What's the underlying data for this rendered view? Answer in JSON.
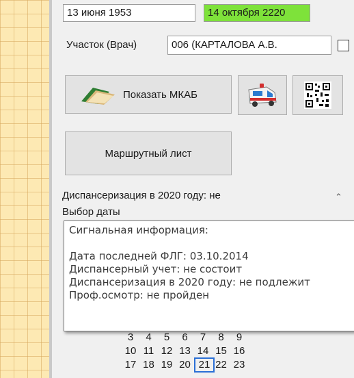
{
  "header": {
    "birth_date": "13 июня 1953",
    "valid_date": "14 октября 2220",
    "valid_date_color": "#7ee23a",
    "district_label": "Участок (Врач)",
    "district_value": "006  (КАРТАЛОВА А.В."
  },
  "buttons": {
    "show_mkab": "Показать МКАБ",
    "ambulance_icon": "ambulance-icon",
    "qr_icon": "qr-code-icon",
    "route_sheet": "Маршрутный лист"
  },
  "dispensary": {
    "status_text": "Диспансеризация в 2020 году: не",
    "date_choice": "Выбор даты"
  },
  "tooltip": {
    "title": "Сигнальная информация:",
    "lines": [
      "Дата последней ФЛГ: 03.10.2014",
      "Диспансерный учет: не состоит",
      "Диспансеризация в 2020 году: не подлежит",
      "Проф.осмотр: не пройден"
    ]
  },
  "calendar": {
    "rows": [
      [
        "3",
        "4",
        "5",
        "6",
        "7",
        "8",
        "9"
      ],
      [
        "10",
        "11",
        "12",
        "13",
        "14",
        "15",
        "16"
      ],
      [
        "17",
        "18",
        "19",
        "20",
        "21",
        "22",
        "23"
      ]
    ],
    "today": "21",
    "today_color": "#2a6fd6"
  }
}
